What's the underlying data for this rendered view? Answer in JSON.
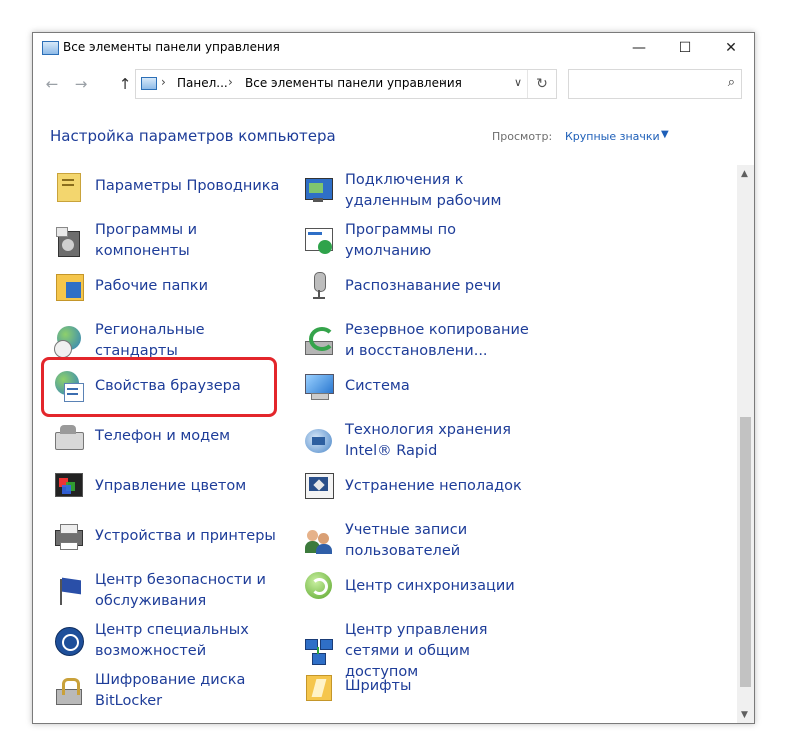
{
  "window": {
    "title": "Все элементы панели управления",
    "controls": [
      "—",
      "☐",
      "✕"
    ]
  },
  "nav": {
    "back": "←",
    "forward": "→",
    "up": "↑",
    "breadcrumbs": [
      "Панел...",
      "Все элементы панели управления"
    ],
    "separator": "›",
    "dropdown": "∨",
    "refresh": "↻",
    "search_placeholder": "",
    "search_icon": "⌕"
  },
  "header": {
    "title": "Настройка параметров компьютера",
    "view_label": "Просмотр:",
    "view_value": "Крупные значки",
    "view_caret": "▼"
  },
  "items_left": [
    {
      "label": "Параметры Проводника",
      "icon": "folder-options-icon"
    },
    {
      "label": "Программы и компоненты",
      "icon": "programs-features-icon"
    },
    {
      "label": "Рабочие папки",
      "icon": "work-folders-icon"
    },
    {
      "label": "Региональные стандарты",
      "icon": "region-globe-clock-icon"
    },
    {
      "label": "Свойства браузера",
      "icon": "internet-options-globe-icon"
    },
    {
      "label": "Телефон и модем",
      "icon": "phone-modem-icon"
    },
    {
      "label": "Управление цветом",
      "icon": "color-management-icon"
    },
    {
      "label": "Устройства и принтеры",
      "icon": "devices-printers-icon"
    },
    {
      "label": "Центр безопасности и обслуживания",
      "icon": "security-flag-icon"
    },
    {
      "label": "Центр специальных возможностей",
      "icon": "ease-of-access-icon"
    },
    {
      "label": "Шифрование диска BitLocker",
      "icon": "bitlocker-lock-icon"
    }
  ],
  "items_right": [
    {
      "label": "Подключения к удаленным рабочим",
      "icon": "remote-desktop-icon"
    },
    {
      "label": "Программы по умолчанию",
      "icon": "default-programs-icon"
    },
    {
      "label": "Распознавание речи",
      "icon": "microphone-icon"
    },
    {
      "label": "Резервное копирование и восстановлени...",
      "icon": "backup-restore-icon"
    },
    {
      "label": "Система",
      "icon": "system-monitor-icon"
    },
    {
      "label": "Технология хранения Intel® Rapid",
      "icon": "intel-rapid-storage-icon"
    },
    {
      "label": "Устранение неполадок",
      "icon": "troubleshooting-icon"
    },
    {
      "label": "Учетные записи пользователей",
      "icon": "user-accounts-icon"
    },
    {
      "label": "Центр синхронизации",
      "icon": "sync-center-icon"
    },
    {
      "label": "Центр управления сетями и общим доступом",
      "icon": "network-center-icon"
    },
    {
      "label": "Шрифты",
      "icon": "fonts-folder-icon"
    }
  ],
  "scrollbar": {
    "up": "▲",
    "down": "▼"
  },
  "colors": {
    "link": "#1e3d99",
    "highlight": "#e3262b"
  }
}
